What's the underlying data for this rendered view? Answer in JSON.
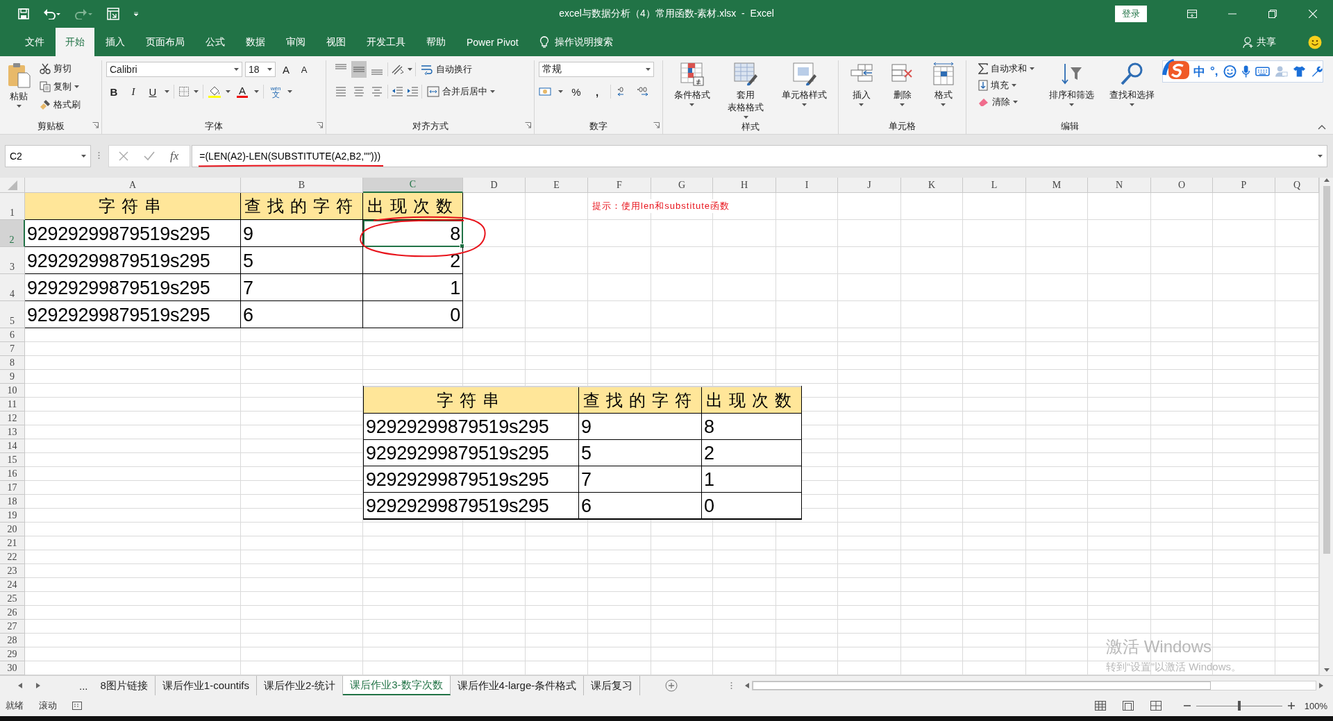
{
  "window": {
    "title": "excel与数据分析（4）常用函数-素材.xlsx  -  Excel",
    "login": "登录"
  },
  "menu_tabs": [
    {
      "label": "文件",
      "selected": false
    },
    {
      "label": "开始",
      "selected": true
    },
    {
      "label": "插入",
      "selected": false
    },
    {
      "label": "页面布局",
      "selected": false
    },
    {
      "label": "公式",
      "selected": false
    },
    {
      "label": "数据",
      "selected": false
    },
    {
      "label": "审阅",
      "selected": false
    },
    {
      "label": "视图",
      "selected": false
    },
    {
      "label": "开发工具",
      "selected": false
    },
    {
      "label": "帮助",
      "selected": false
    },
    {
      "label": "Power Pivot",
      "selected": false
    }
  ],
  "tell_me": "操作说明搜索",
  "share": "共享",
  "ribbon": {
    "clipboard": {
      "title": "剪贴板",
      "paste": "粘贴",
      "cut": "剪切",
      "copy": "复制",
      "format_painter": "格式刷"
    },
    "font": {
      "title": "字体",
      "font_name": "Calibri",
      "font_size": "18",
      "grow": "A",
      "shrink": "A",
      "bold": "B",
      "italic": "I",
      "underline": "U",
      "font_color": "A",
      "phonetic": "文",
      "phonetic_reading": "wén"
    },
    "alignment": {
      "title": "对齐方式",
      "vertical": [
        {
          "selected": false
        },
        {
          "selected": true
        },
        {
          "selected": false
        }
      ],
      "wrap_text": "自动换行",
      "merge_center": "合并后居中"
    },
    "number": {
      "title": "数字",
      "format": "常规",
      "percent": "%",
      "comma": ","
    },
    "styles": {
      "title": "样式",
      "buttons": [
        {
          "lines": [
            "条件格式"
          ]
        },
        {
          "lines": [
            "套用",
            "表格格式"
          ]
        },
        {
          "lines": [
            "单元格样式"
          ]
        }
      ]
    },
    "cells": {
      "title": "单元格",
      "buttons": [
        "插入",
        "删除",
        "格式"
      ]
    },
    "editing": {
      "title": "编辑",
      "autosum": "自动求和",
      "fill": "填充",
      "clear": "清除",
      "sort_filter": "排序和筛选",
      "find_select": "查找和选择"
    }
  },
  "ime_toolbar": {
    "mode": "中",
    "punctuation": "°,"
  },
  "formula_bar": {
    "name_box": "C2",
    "fx": "fx",
    "formula": "=(LEN(A2)-LEN(SUBSTITUTE(A2,B2,\"\")))"
  },
  "sheet": {
    "columns": [
      {
        "label": "A",
        "selected": false
      },
      {
        "label": "B",
        "selected": false
      },
      {
        "label": "C",
        "selected": true
      },
      {
        "label": "D",
        "selected": false
      },
      {
        "label": "E",
        "selected": false
      },
      {
        "label": "F",
        "selected": false
      },
      {
        "label": "G",
        "selected": false
      },
      {
        "label": "H",
        "selected": false
      },
      {
        "label": "I",
        "selected": false
      },
      {
        "label": "J",
        "selected": false
      },
      {
        "label": "K",
        "selected": false
      },
      {
        "label": "L",
        "selected": false
      },
      {
        "label": "M",
        "selected": false
      },
      {
        "label": "N",
        "selected": false
      },
      {
        "label": "O",
        "selected": false
      },
      {
        "label": "P",
        "selected": false
      },
      {
        "label": "Q",
        "selected": false
      }
    ],
    "rows": [
      {
        "label": "1",
        "selected": false
      },
      {
        "label": "2",
        "selected": true
      },
      {
        "label": "3",
        "selected": false
      },
      {
        "label": "4",
        "selected": false
      },
      {
        "label": "5",
        "selected": false
      },
      {
        "label": "6",
        "selected": false
      },
      {
        "label": "7",
        "selected": false
      },
      {
        "label": "8",
        "selected": false
      },
      {
        "label": "9",
        "selected": false
      },
      {
        "label": "10",
        "selected": false
      },
      {
        "label": "11",
        "selected": false
      },
      {
        "label": "12",
        "selected": false
      },
      {
        "label": "13",
        "selected": false
      },
      {
        "label": "14",
        "selected": false
      },
      {
        "label": "15",
        "selected": false
      },
      {
        "label": "16",
        "selected": false
      },
      {
        "label": "17",
        "selected": false
      },
      {
        "label": "18",
        "selected": false
      },
      {
        "label": "19",
        "selected": false
      },
      {
        "label": "20",
        "selected": false
      },
      {
        "label": "21",
        "selected": false
      },
      {
        "label": "22",
        "selected": false
      },
      {
        "label": "23",
        "selected": false
      },
      {
        "label": "24",
        "selected": false
      },
      {
        "label": "25",
        "selected": false
      },
      {
        "label": "26",
        "selected": false
      },
      {
        "label": "27",
        "selected": false
      },
      {
        "label": "28",
        "selected": false
      },
      {
        "label": "29",
        "selected": false
      },
      {
        "label": "30",
        "selected": false
      }
    ],
    "table": {
      "header": [
        "字符串",
        "查找的字符",
        "出现次数"
      ],
      "rows": [
        [
          {
            "text": "92929299879519s295",
            "selected": false
          },
          {
            "text": "9",
            "selected": false
          },
          {
            "text": "8",
            "selected": true
          }
        ],
        [
          {
            "text": "92929299879519s295",
            "selected": false
          },
          {
            "text": "5",
            "selected": false
          },
          {
            "text": "2",
            "selected": false
          }
        ],
        [
          {
            "text": "92929299879519s295",
            "selected": false
          },
          {
            "text": "7",
            "selected": false
          },
          {
            "text": "1",
            "selected": false
          }
        ],
        [
          {
            "text": "92929299879519s295",
            "selected": false
          },
          {
            "text": "6",
            "selected": false
          },
          {
            "text": "0",
            "selected": false
          }
        ]
      ]
    },
    "hint": "提示：使用len和substitute函数"
  },
  "pasted_table": {
    "header": [
      "字符串",
      "查找的字符",
      "出现次数"
    ],
    "rows": [
      [
        "92929299879519s295",
        "9",
        "8"
      ],
      [
        "92929299879519s295",
        "5",
        "2"
      ],
      [
        "92929299879519s295",
        "7",
        "1"
      ],
      [
        "92929299879519s295",
        "6",
        "0"
      ]
    ]
  },
  "watermark": [
    "激活 Windows",
    "转到“设置”以激活 Windows。"
  ],
  "sheet_tabs": {
    "overflow": "...",
    "tabs": [
      {
        "label": "8图片链接",
        "selected": false
      },
      {
        "label": "课后作业1-countifs",
        "selected": false
      },
      {
        "label": "课后作业2-统计",
        "selected": false
      },
      {
        "label": "课后作业3-数字次数",
        "selected": true
      },
      {
        "label": "课后作业4-large-条件格式",
        "selected": false
      },
      {
        "label": "课后复习",
        "selected": false
      }
    ]
  },
  "status_bar": {
    "mode": "就绪",
    "scroll": "滚动",
    "zoom": {
      "level": 0.5
    },
    "zoom_text": "100%"
  }
}
